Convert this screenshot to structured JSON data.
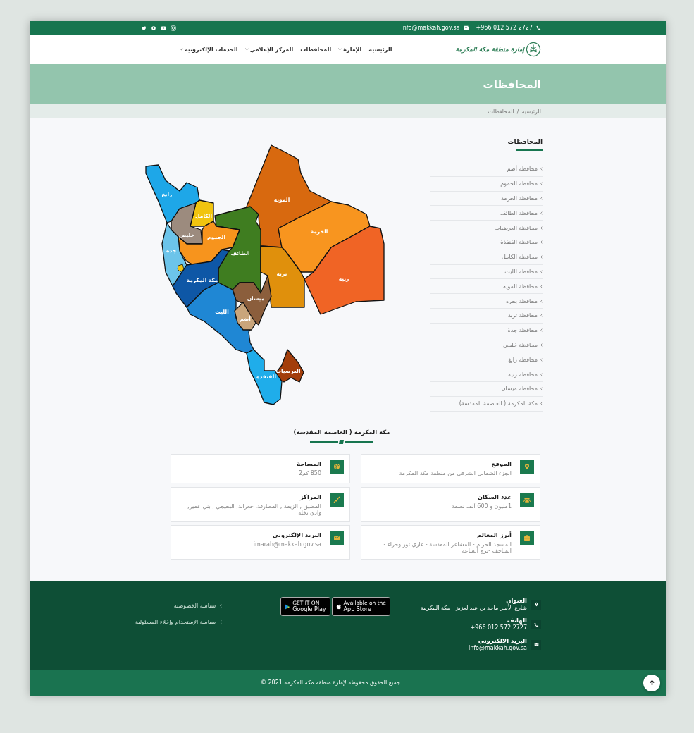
{
  "top_bar": {
    "email": "info@makkah.gov.sa",
    "phone": "+966 012 572 2727"
  },
  "nav": {
    "logo_text": "إمارة منطقة مكة المكرمة",
    "items": [
      {
        "label": "الرئيسية",
        "has_dropdown": false
      },
      {
        "label": "الإمارة",
        "has_dropdown": true
      },
      {
        "label": "المحافظات",
        "has_dropdown": false
      },
      {
        "label": "المركز الإعلامي",
        "has_dropdown": true
      },
      {
        "label": "الخدمات الإلكترونية",
        "has_dropdown": true
      }
    ]
  },
  "hero": {
    "title": "المحافظات"
  },
  "breadcrumb": {
    "items": [
      "الرئيسية",
      "المحافظات"
    ],
    "separator": "/"
  },
  "sidebar": {
    "title": "المحافظات",
    "items": [
      "محافظة أضم",
      "محافظة الجموم",
      "محافظة الخرمة",
      "محافظة الطائف",
      "محافظة العرضيات",
      "محافظة القنفذة",
      "محافظة الكامل",
      "محافظة الليث",
      "محافظة المويه",
      "محافظة بحرة",
      "محافظة تربة",
      "محافظة جدة",
      "محافظة خليص",
      "محافظة رابغ",
      "محافظة رنية",
      "محافظة ميسان",
      "مكة المكرمة ( العاصمة المقدسة)"
    ]
  },
  "map": {
    "regions": [
      {
        "name": "المويه",
        "color": "#d8690f"
      },
      {
        "name": "رابغ",
        "color": "#1ea7e8"
      },
      {
        "name": "الخرمة",
        "color": "#f8951f"
      },
      {
        "name": "الكامل",
        "color": "#f1c40f"
      },
      {
        "name": "خليص",
        "color": "#9c8b7e"
      },
      {
        "name": "الطائف",
        "color": "#3f7d20"
      },
      {
        "name": "الجموم",
        "color": "#f7941d"
      },
      {
        "name": "جدة",
        "color": "#6cc4ea"
      },
      {
        "name": "رنية",
        "color": "#f06425"
      },
      {
        "name": "تربة",
        "color": "#e0900c"
      },
      {
        "name": "مكة المكرمة",
        "color": "#0e57a6"
      },
      {
        "name": "ميسان",
        "color": "#8b5e3c"
      },
      {
        "name": "الليث",
        "color": "#1f87d4"
      },
      {
        "name": "أضم",
        "color": "#c9a57b"
      },
      {
        "name": "العرضيات",
        "color": "#a33e0b"
      },
      {
        "name": "القنفذة",
        "color": "#1fadea"
      }
    ]
  },
  "governorate": {
    "title": "مكة المكرمة ( العاصمة المقدسة)",
    "cards": [
      {
        "kind": "location",
        "label": "الموقع",
        "value": "الجزء الشمالي الشرقي من منطقة مكة المكرمة"
      },
      {
        "kind": "area",
        "label": "المساحة",
        "value": "850 كم2"
      },
      {
        "kind": "population",
        "label": "عدد السكان",
        "value": "1مليون و 600 ألف نسمة"
      },
      {
        "kind": "centers",
        "label": "المراكز",
        "value": "المضيق , الزيمة , المطارفة, جعرانة, البحيجي , بني عمير, وادي نخلة"
      },
      {
        "kind": "landmarks",
        "label": "أبرز المعالم",
        "value": "المسجد الحرام - المشاعر المقدسة - غاري ثور وحراء - المتاحف -برج الساعة"
      },
      {
        "kind": "email",
        "label": "البريد الإلكتروني",
        "value": "imarah@makkah.gov.sa"
      }
    ]
  },
  "footer": {
    "contacts": [
      {
        "kind": "address",
        "label": "العنوان",
        "value": "شارع الأمير ماجد بن عبدالعزيز - مكة المكرمة"
      },
      {
        "kind": "phone",
        "label": "الهاتف",
        "value": "+966 012 572 2727"
      },
      {
        "kind": "email",
        "label": "البريد الالكتروني",
        "value": "info@makkah.gov.sa"
      }
    ],
    "badges": [
      {
        "kind": "apple",
        "small": "Available on the",
        "big": "App Store"
      },
      {
        "kind": "google",
        "small": "GET IT ON",
        "big": "Google Play"
      }
    ],
    "links": [
      "سياسة الخصوصية",
      "سياسة الإستخدام وإخلاء المسئولية"
    ],
    "copyright": "جميع الحقوق محفوظة لإمارة منطقة مكة المكرمة 2021 ©"
  }
}
